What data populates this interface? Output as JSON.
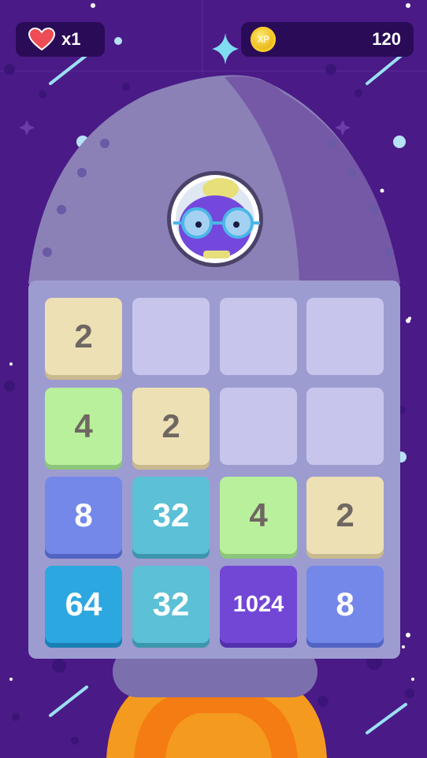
{
  "hud": {
    "lives": {
      "icon": "heart-icon",
      "count_text": "x1"
    },
    "xp": {
      "icon": "xp-coin-icon",
      "coin_label": "XP",
      "value": "120"
    }
  },
  "board": {
    "rows": [
      [
        "2",
        "",
        "",
        ""
      ],
      [
        "4",
        "2",
        "",
        ""
      ],
      [
        "8",
        "32",
        "4",
        "2"
      ],
      [
        "64",
        "32",
        "1024",
        "8"
      ]
    ]
  },
  "tile_colors": {
    "2": {
      "bg": "#ede0b5",
      "shadow": "#c9b98e",
      "fg": "#6f6762"
    },
    "4": {
      "bg": "#b9f09c",
      "shadow": "#8dc57a",
      "fg": "#6f6762"
    },
    "8": {
      "bg": "#7488ea",
      "shadow": "#5164c4",
      "fg": "#ffffff"
    },
    "32": {
      "bg": "#5cc0d6",
      "shadow": "#3c96ad",
      "fg": "#ffffff"
    },
    "64": {
      "bg": "#2da7e0",
      "shadow": "#1a7fb4",
      "fg": "#ffffff"
    },
    "1024": {
      "bg": "#7347d6",
      "shadow": "#5330ad",
      "fg": "#ffffff"
    }
  },
  "colors": {
    "background": "#4a1a86",
    "rocket_left": "#8b81b7",
    "rocket_right": "#7559a6",
    "board": "#9d9cd0",
    "empty_cell": "#c8c5ec",
    "flame_outer": "#f49a1f",
    "flame_inner": "#f57c12",
    "hud_panel": "#2a0b57"
  },
  "character": {
    "icon": "robot-pilot-icon"
  }
}
